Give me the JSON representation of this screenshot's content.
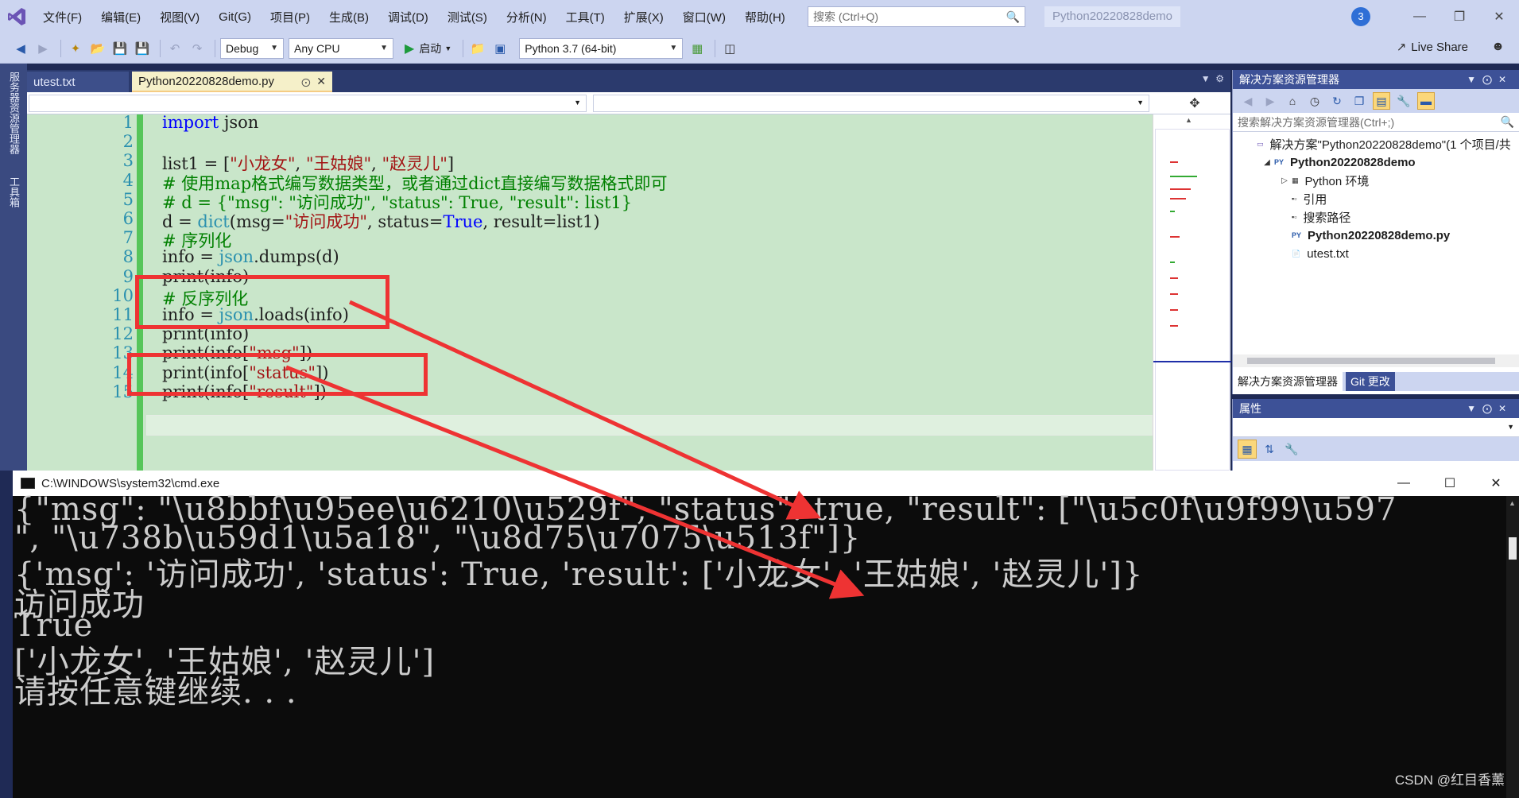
{
  "menu": {
    "items": [
      "文件(F)",
      "编辑(E)",
      "视图(V)",
      "Git(G)",
      "项目(P)",
      "生成(B)",
      "调试(D)",
      "测试(S)",
      "分析(N)",
      "工具(T)",
      "扩展(X)",
      "窗口(W)",
      "帮助(H)"
    ],
    "search_placeholder": "搜索 (Ctrl+Q)",
    "solution_name": "Python20220828demo",
    "notification_count": "3"
  },
  "toolbar": {
    "config": "Debug",
    "platform": "Any CPU",
    "start_label": "启动",
    "environment": "Python 3.7 (64-bit)",
    "live_share": "Live Share"
  },
  "left_tabs": [
    "服务器资源管理器",
    "工具箱"
  ],
  "doc_tabs": [
    {
      "label": "utest.txt",
      "active": false
    },
    {
      "label": "Python20220828demo.py",
      "active": true
    }
  ],
  "editor": {
    "line_numbers": [
      "1",
      "2",
      "3",
      "4",
      "5",
      "6",
      "7",
      "8",
      "9",
      "10",
      "11",
      "12",
      "13",
      "14",
      "15"
    ],
    "lines": [
      [
        {
          "t": "import",
          "c": "kw"
        },
        {
          "t": " json",
          "c": ""
        }
      ],
      [],
      [
        {
          "t": "list1 = [",
          "c": ""
        },
        {
          "t": "\"小龙女\"",
          "c": "str"
        },
        {
          "t": ", ",
          "c": ""
        },
        {
          "t": "\"王姑娘\"",
          "c": "str"
        },
        {
          "t": ", ",
          "c": ""
        },
        {
          "t": "\"赵灵儿\"",
          "c": "str"
        },
        {
          "t": "]",
          "c": ""
        }
      ],
      [
        {
          "t": "# 使用map格式编写数据类型，或者通过dict直接编写数据格式即可",
          "c": "cmt"
        }
      ],
      [
        {
          "t": "# d = {\"msg\": \"访问成功\", \"status\": True, \"result\": list1}",
          "c": "cmt"
        }
      ],
      [
        {
          "t": "d = ",
          "c": ""
        },
        {
          "t": "dict",
          "c": "bi"
        },
        {
          "t": "(msg=",
          "c": ""
        },
        {
          "t": "\"访问成功\"",
          "c": "str"
        },
        {
          "t": ", status=",
          "c": ""
        },
        {
          "t": "True",
          "c": "kw"
        },
        {
          "t": ", result=list1)",
          "c": ""
        }
      ],
      [
        {
          "t": "# 序列化",
          "c": "cmt"
        }
      ],
      [
        {
          "t": "info = ",
          "c": ""
        },
        {
          "t": "json",
          "c": "bi"
        },
        {
          "t": ".dumps(d)",
          "c": ""
        }
      ],
      [
        {
          "t": "print",
          "c": ""
        },
        {
          "t": "(info)",
          "c": ""
        }
      ],
      [
        {
          "t": "# 反序列化",
          "c": "cmt"
        }
      ],
      [
        {
          "t": "info = ",
          "c": ""
        },
        {
          "t": "json",
          "c": "bi"
        },
        {
          "t": ".loads(info)",
          "c": ""
        }
      ],
      [
        {
          "t": "print",
          "c": ""
        },
        {
          "t": "(info)",
          "c": ""
        }
      ],
      [
        {
          "t": "print(info[",
          "c": ""
        },
        {
          "t": "\"msg\"",
          "c": "str"
        },
        {
          "t": "])",
          "c": ""
        }
      ],
      [
        {
          "t": "print(info[",
          "c": ""
        },
        {
          "t": "\"status\"",
          "c": "str"
        },
        {
          "t": "])",
          "c": ""
        }
      ],
      [
        {
          "t": "print(info[",
          "c": ""
        },
        {
          "t": "\"result\"",
          "c": "str"
        },
        {
          "t": "])",
          "c": ""
        }
      ]
    ]
  },
  "solution_explorer": {
    "title": "解决方案资源管理器",
    "search_placeholder": "搜索解决方案资源管理器(Ctrl+;)",
    "tree": [
      {
        "label": "解决方案\"Python20220828demo\"(1 个项目/共",
        "indent": 0,
        "icon": "solution-icon",
        "bold": false,
        "exp": ""
      },
      {
        "label": "Python20220828demo",
        "indent": 1,
        "icon": "python-project-icon",
        "bold": true,
        "exp": "◢"
      },
      {
        "label": "Python 环境",
        "indent": 2,
        "icon": "environment-icon",
        "bold": false,
        "exp": "▷"
      },
      {
        "label": "引用",
        "indent": 2,
        "icon": "reference-icon",
        "bold": false,
        "exp": ""
      },
      {
        "label": "搜索路径",
        "indent": 2,
        "icon": "search-path-icon",
        "bold": false,
        "exp": ""
      },
      {
        "label": "Python20220828demo.py",
        "indent": 2,
        "icon": "python-file-icon",
        "bold": true,
        "exp": ""
      },
      {
        "label": "utest.txt",
        "indent": 2,
        "icon": "text-file-icon",
        "bold": false,
        "exp": ""
      }
    ],
    "tabs": [
      "解决方案资源管理器",
      "Git 更改"
    ]
  },
  "properties": {
    "title": "属性"
  },
  "console": {
    "title": "C:\\WINDOWS\\system32\\cmd.exe",
    "lines": [
      "{\"msg\": \"\\u8bbf\\u95ee\\u6210\\u529f\", \"status\": true, \"result\": [\"\\u5c0f\\u9f99\\u597",
      "\", \"\\u738b\\u59d1\\u5a18\", \"\\u8d75\\u7075\\u513f\"]}",
      "{'msg': '访问成功', 'status': True, 'result': ['小龙女', '王姑娘', '赵灵儿']}",
      "访问成功",
      "True",
      "['小龙女', '王姑娘', '赵灵儿']",
      "请按任意键继续. . ."
    ],
    "watermark": "CSDN @红目香薰"
  },
  "colors": {
    "annotation": "#ee3333",
    "editor_bg": "#c9e6ca",
    "chrome": "#ccd5f0",
    "panel_title": "#3d5197"
  }
}
